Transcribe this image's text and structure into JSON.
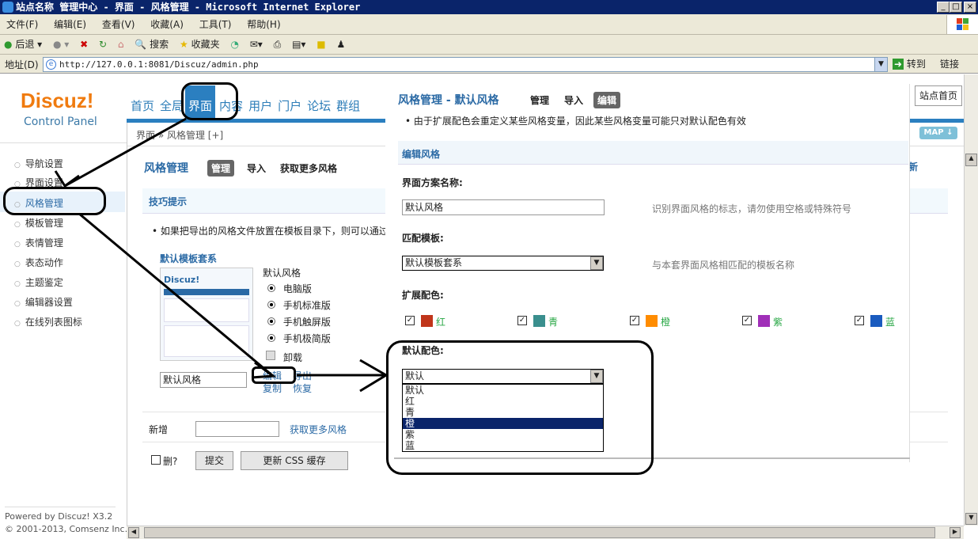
{
  "window": {
    "title": "站点名称 管理中心 - 界面 - 风格管理 - Microsoft Internet Explorer"
  },
  "menu": [
    "文件(F)",
    "编辑(E)",
    "查看(V)",
    "收藏(A)",
    "工具(T)",
    "帮助(H)"
  ],
  "toolbar": {
    "back": "后退",
    "search": "搜索",
    "favorites": "收藏夹"
  },
  "address": {
    "label": "地址(D)",
    "url": "http://127.0.0.1:8081/Discuz/admin.php",
    "go": "转到",
    "links": "链接"
  },
  "logo": {
    "brand": "Discuz!",
    "sub": "Control Panel"
  },
  "nav": [
    "首页",
    "全局",
    "界面",
    "内容",
    "用户",
    "门户",
    "论坛",
    "群组"
  ],
  "site_home": "站点首页",
  "map": "MAP",
  "breadcrumb": "界面 » 风格管理  [+]",
  "sidebar": [
    "导航设置",
    "界面设置",
    "风格管理",
    "模板管理",
    "表情管理",
    "表态动作",
    "主题鉴定",
    "编辑器设置",
    "在线列表图标"
  ],
  "footer": {
    "powered": "Powered by Discuz! X3.2",
    "copy": "© 2001-2013, Comsenz Inc."
  },
  "main": {
    "title": "风格管理",
    "tab_manage": "管理",
    "tab_import": "导入",
    "tab_more": "获取更多风格",
    "tips_title": "技巧提示",
    "tip": "如果把导出的风格文件放置在模板目录下，则可以通过",
    "style_name": "默认模板套系",
    "style_label": "默认风格",
    "radios": [
      "电脑版",
      "手机标准版",
      "手机触屏版",
      "手机极简版"
    ],
    "uninstall": "卸载",
    "name_value": "默认风格",
    "edit": "编辑",
    "export": "导出",
    "copy": "复制",
    "restore": "恢复",
    "new_label": "新增",
    "get_more": "获取更多风格",
    "delete": "删?",
    "submit": "提交",
    "update_css": "更新 CSS 缓存"
  },
  "popup": {
    "title": "风格管理 - 默认风格",
    "tab_manage": "管理",
    "tab_import": "导入",
    "tab_edit": "编辑",
    "tip": "由于扩展配色会重定义某些风格变量，因此某些风格变量可能只对默认配色有效",
    "section": "编辑风格",
    "scheme_label": "界面方案名称:",
    "scheme_value": "默认风格",
    "scheme_hint": "识别界面风格的标志，请勿使用空格或特殊符号",
    "tpl_label": "匹配模板:",
    "tpl_value": "默认模板套系",
    "tpl_hint": "与本套界面风格相匹配的模板名称",
    "ext_label": "扩展配色:",
    "colors": [
      {
        "name": "红",
        "hex": "#c0351a"
      },
      {
        "name": "青",
        "hex": "#3a8f8e"
      },
      {
        "name": "橙",
        "hex": "#ff8c00"
      },
      {
        "name": "紫",
        "hex": "#a02fb8"
      },
      {
        "name": "蓝",
        "hex": "#1a5bbf"
      }
    ],
    "default_label": "默认配色:",
    "default_value": "默认",
    "options": [
      "默认",
      "红",
      "青",
      "橙",
      "紫",
      "蓝"
    ],
    "selected_option": "橙"
  }
}
